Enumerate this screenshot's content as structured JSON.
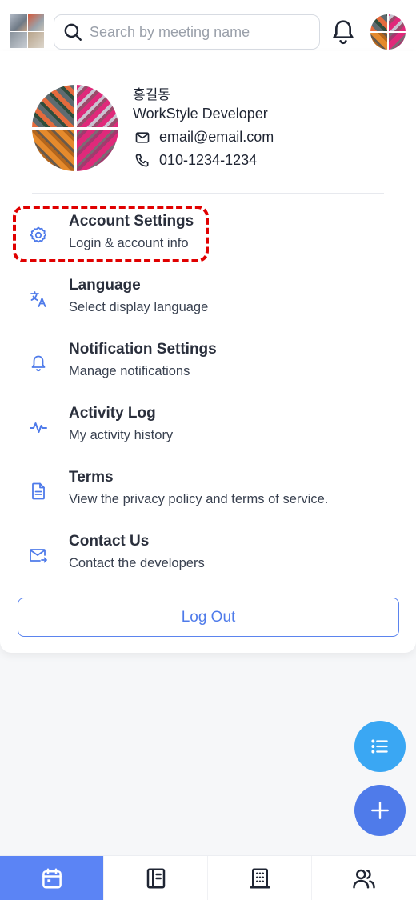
{
  "header": {
    "search": {
      "placeholder": "Search by meeting name",
      "value": ""
    },
    "icons": [
      "app-logo",
      "search-icon",
      "bell-icon",
      "avatar"
    ]
  },
  "profile": {
    "name": "홍길동",
    "role": "WorkStyle Developer",
    "email": "email@email.com",
    "phone": "010-1234-1234"
  },
  "menu": [
    {
      "title": "Account Settings",
      "subtitle": "Login & account info",
      "icon": "gear-icon",
      "highlighted": true
    },
    {
      "title": "Language",
      "subtitle": "Select display language",
      "icon": "translate-icon"
    },
    {
      "title": "Notification Settings",
      "subtitle": "Manage notifications",
      "icon": "bell-icon"
    },
    {
      "title": "Activity Log",
      "subtitle": "My activity history",
      "icon": "activity-icon"
    },
    {
      "title": "Terms",
      "subtitle": "View the privacy policy and terms of service.",
      "icon": "document-icon"
    },
    {
      "title": "Contact Us",
      "subtitle": "Contact the developers",
      "icon": "mail-send-icon"
    }
  ],
  "logout_label": "Log Out",
  "fabs": [
    "list-icon",
    "plus-icon"
  ],
  "bottom_nav": {
    "tabs": [
      "calendar-icon",
      "notebook-icon",
      "building-icon",
      "users-icon"
    ],
    "active_index": 0
  },
  "colors": {
    "accent": "#4f7bea",
    "fab_list": "#3aa7f3",
    "active_tab": "#5b84f5",
    "highlight_border": "#e00000"
  }
}
